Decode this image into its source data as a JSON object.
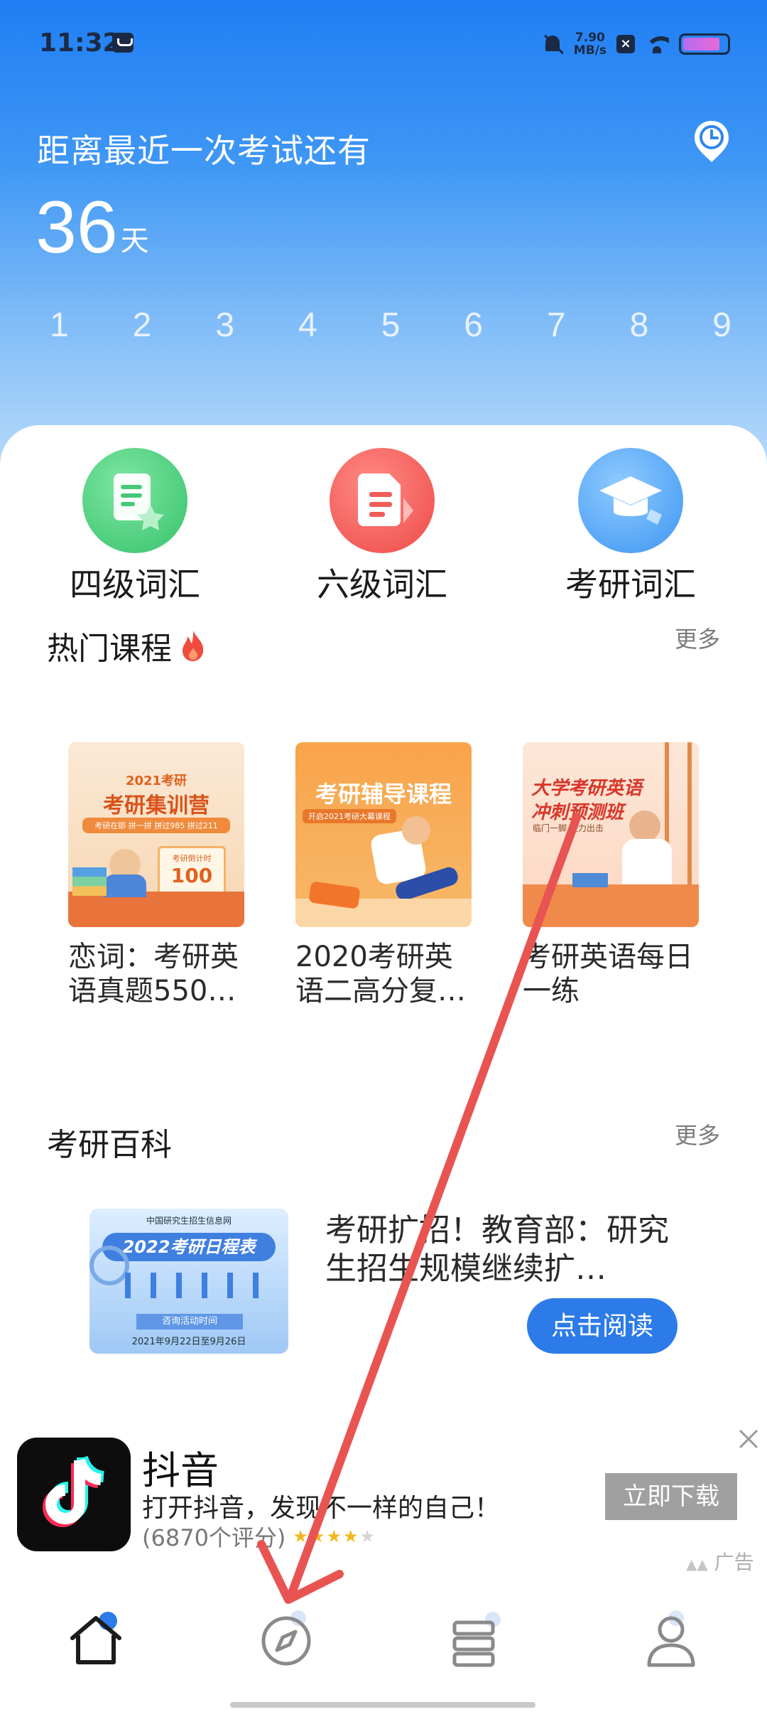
{
  "status_bar": {
    "time": "11:32",
    "net_speed_value": "7.90",
    "net_speed_unit": "MB/s",
    "battery_level": 0.85
  },
  "exam": {
    "title": "距离最近一次考试还有",
    "days_value": "36",
    "days_unit": "天",
    "day_strip": [
      "1",
      "2",
      "3",
      "4",
      "5",
      "6",
      "7",
      "8",
      "9"
    ]
  },
  "vocab": [
    {
      "label": "四级词汇",
      "color": "#4fcf7e"
    },
    {
      "label": "六级词汇",
      "color": "#f25a55"
    },
    {
      "label": "考研词汇",
      "color": "#4ea5f6"
    }
  ],
  "hot_courses": {
    "title": "热门课程",
    "more": "更多",
    "items": [
      {
        "title": "恋词：考研英语真题550…",
        "thumb": {
          "badge": "2021考研",
          "heading": "考研集训营",
          "sub": "考研在即 拼一拼 拼过985 拼过211",
          "card": "考研倒计时",
          "card_num": "100"
        }
      },
      {
        "title": "2020考研英语二高分复…",
        "thumb": {
          "heading": "考研辅导课程",
          "sub": "开启2021考研大幕课程"
        }
      },
      {
        "title": "考研英语每日一练",
        "thumb": {
          "heading_1": "大学考研英语",
          "heading_2": "冲刺预测班",
          "sub": "临门一脚 全力出击"
        }
      }
    ]
  },
  "wiki": {
    "title": "考研百科",
    "more": "更多",
    "article": {
      "text": "考研扩招！教育部：研究生招生规模继续扩…",
      "button": "点击阅读",
      "thumb": {
        "org": "中国研究生招生信息网",
        "heading": "2022考研日程表",
        "sub": "咨询活动时间",
        "date": "2021年9月22日至9月26日"
      }
    }
  },
  "ad": {
    "app_name": "抖音",
    "desc": "打开抖音，发现不一样的自己！",
    "rating_text": "(6870个评分)",
    "stars": 3.5,
    "download": "立即下载",
    "tag": "广告"
  },
  "nav": {
    "items": [
      "home",
      "discover",
      "courses",
      "profile"
    ]
  },
  "colors": {
    "primary": "#2c7be8",
    "header_top": "#1f7ef3",
    "annotation": "#e85452"
  }
}
